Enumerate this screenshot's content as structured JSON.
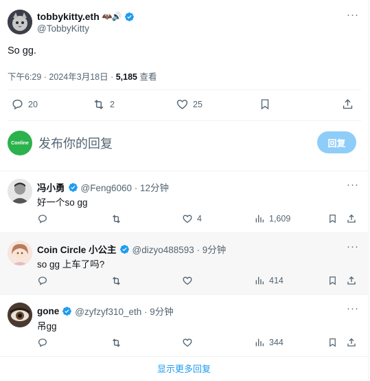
{
  "main_tweet": {
    "name": "tobbykitty.eth",
    "name_emojis": "🦇🔊",
    "handle": "@TobbyKitty",
    "text": "So gg.",
    "time": "下午6:29 · 2024年3月18日 · ",
    "views_count": "5,185",
    "views_label": " 查看",
    "reply_count": "20",
    "retweet_count": "2",
    "like_count": "25"
  },
  "composer": {
    "avatar_text": "Conline",
    "placeholder": "发布你的回复",
    "button_label": "回复"
  },
  "replies": [
    {
      "name": "冯小勇",
      "handle": "@Feng6060 · 12分钟",
      "text": "好一个so gg",
      "replies": "",
      "retweets": "",
      "likes": "4",
      "views": "1,609"
    },
    {
      "name": "Coin Circle 小公主",
      "handle": "@dizyo488593 · 9分钟",
      "text": "so gg 上车了吗?",
      "replies": "",
      "retweets": "",
      "likes": "",
      "views": "414"
    },
    {
      "name": "gone",
      "handle": "@zyfzyf310_eth · 9分钟",
      "text": "吊gg",
      "replies": "",
      "retweets": "",
      "likes": "",
      "views": "344"
    }
  ],
  "show_more": "显示更多回复",
  "colors": {
    "accent": "#1d9bf0",
    "verified": "#1d9bf0",
    "secondary_text": "#536471",
    "reply_button": "#8ecdf8",
    "composer_avatar": "#2bb24c"
  }
}
